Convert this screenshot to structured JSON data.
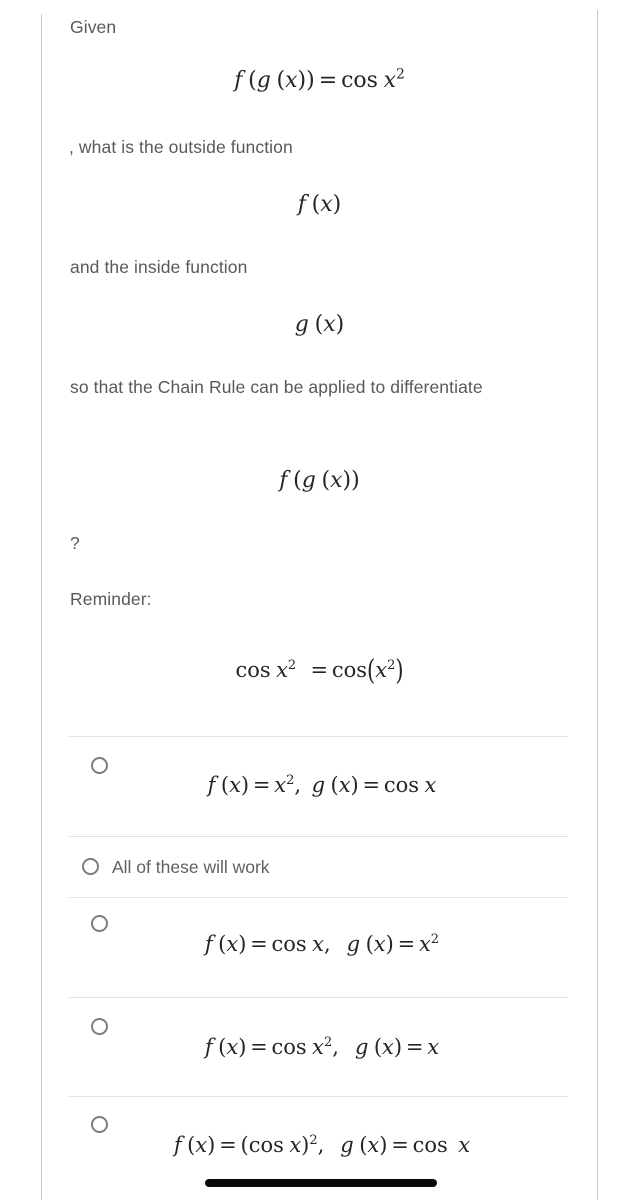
{
  "question": {
    "intro_label": "Given",
    "given_equation": "f(g(x)) = cos x²",
    "prompt_part1": ", what is the outside function",
    "outside_function": "f(x)",
    "prompt_part2": "and the inside function",
    "inside_function": "g(x)",
    "prompt_part3": "so that the Chain Rule can be applied to differentiate",
    "composite_function": "f(g(x))",
    "question_mark": "?",
    "reminder_label": "Reminder:",
    "reminder_equation": "cos x² = cos(x²)"
  },
  "options": [
    {
      "id": "option-1",
      "kind": "math",
      "text": "f(x) = x², g(x) = cos x",
      "selected": false
    },
    {
      "id": "option-2",
      "kind": "text",
      "text": "All of these will work",
      "selected": false
    },
    {
      "id": "option-3",
      "kind": "math",
      "text": "f(x) = cos x,  g(x) = x²",
      "selected": false
    },
    {
      "id": "option-4",
      "kind": "math",
      "text": "f(x) = cos x²,  g(x) = x",
      "selected": false
    },
    {
      "id": "option-5",
      "kind": "math",
      "text": "f(x) = (cos x)²,  g(x) = cos x",
      "selected": false
    }
  ],
  "colors": {
    "prose_text": "#595959",
    "math_text": "#23252b",
    "divider": "#e2e2e2",
    "frame": "#c9c9c9",
    "radio_border": "#7b7f85",
    "scrollbar_thumb": "#a8a8a8",
    "home_indicator": "#0a0a0a",
    "background": "#ffffff"
  },
  "chrome": {
    "scrollbar_name": "vertical-scrollbar",
    "home_indicator_name": "home-indicator"
  }
}
